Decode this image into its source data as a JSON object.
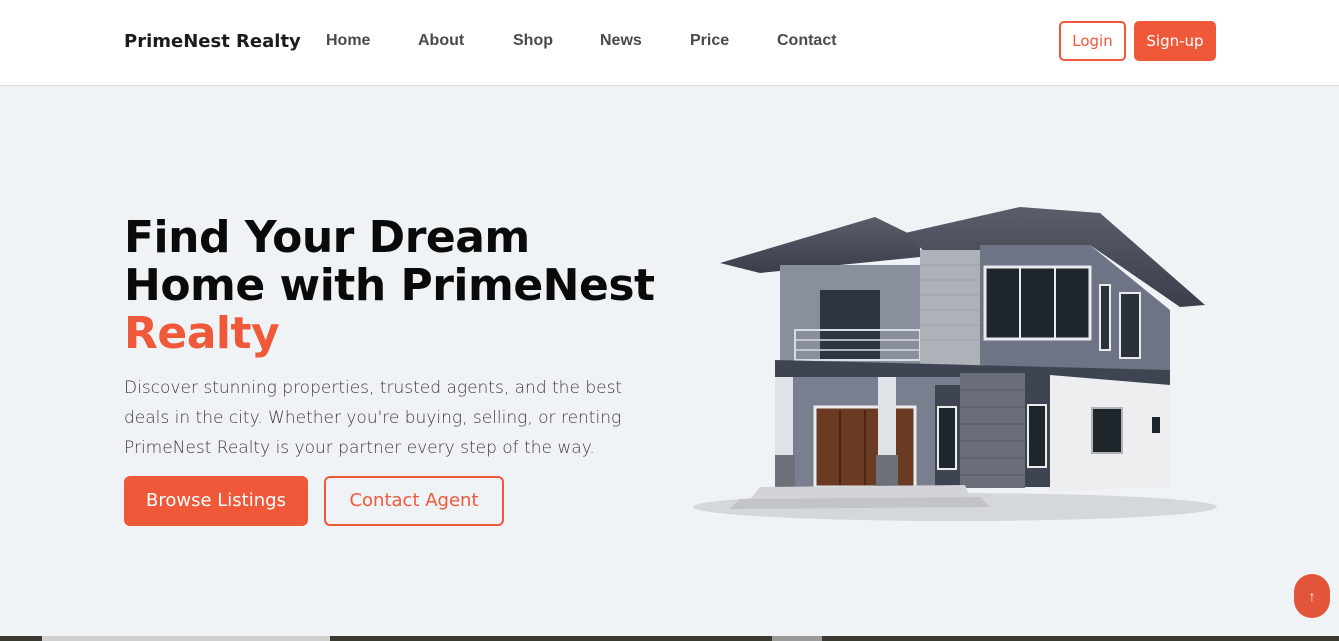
{
  "nav": {
    "brand": "PrimeNest Realty",
    "links": [
      "Home",
      "About",
      "Shop",
      "News",
      "Price",
      "Contact"
    ],
    "login_label": "Login",
    "signup_label": "Sign-up"
  },
  "hero": {
    "title_line1": "Find Your Dream",
    "title_line2": "Home with PrimeNest",
    "title_accent": "Realty",
    "description": "Discover stunning properties, trusted agents, and the best deals in the city. Whether you're buying, selling, or renting PrimeNest Realty is your partner every step of the way.",
    "browse_label": "Browse Listings",
    "contact_label": "Contact Agent"
  },
  "scroll_top_icon": "↑",
  "colors": {
    "accent": "#f0583a",
    "background": "#f0f3f6",
    "text": "#0a0a0a"
  },
  "icons": {
    "hero_image": "house-image",
    "scroll_top": "arrow-up-icon"
  }
}
